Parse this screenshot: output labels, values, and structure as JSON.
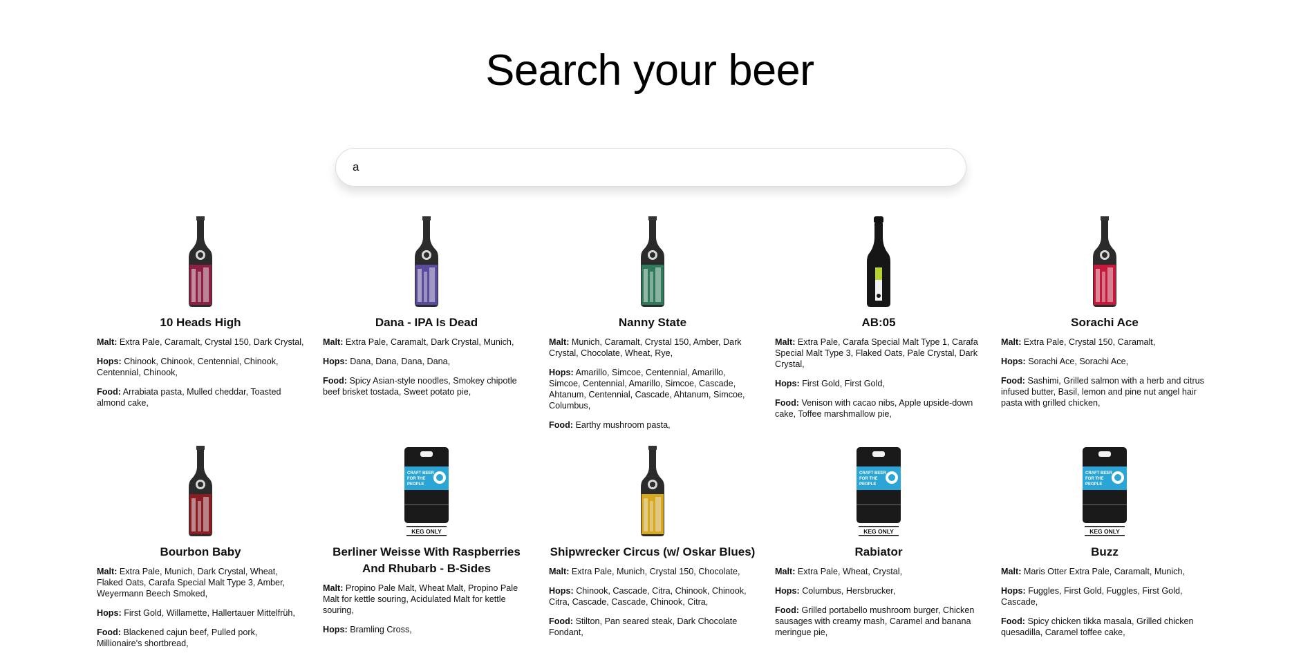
{
  "page": {
    "title": "Search your beer"
  },
  "search": {
    "value": "a",
    "placeholder": ""
  },
  "labels": {
    "malt": "Malt:",
    "hops": "Hops:",
    "food": "Food:"
  },
  "beers": [
    {
      "name": "10 Heads High",
      "malt": "Extra Pale, Caramalt, Crystal 150, Dark Crystal,",
      "hops": "Chinook, Chinook, Centennial, Chinook, Centennial, Chinook,",
      "food": "Arrabiata pasta, Mulled cheddar, Toasted almond cake,",
      "image": "bottle",
      "label_color": "#8e1f45"
    },
    {
      "name": "Dana - IPA Is Dead",
      "malt": "Extra Pale, Caramalt, Dark Crystal, Munich,",
      "hops": "Dana, Dana, Dana, Dana,",
      "food": "Spicy Asian-style noodles, Smokey chipotle beef brisket tostada, Sweet potato pie,",
      "image": "bottle",
      "label_color": "#5b4a9e"
    },
    {
      "name": "Nanny State",
      "malt": "Munich, Caramalt, Crystal 150, Amber, Dark Crystal, Chocolate, Wheat, Rye,",
      "hops": "Amarillo, Simcoe, Centennial, Amarillo, Simcoe, Centennial, Amarillo, Simcoe, Cascade, Ahtanum, Centennial, Cascade, Ahtanum, Simcoe, Columbus,",
      "food": "Earthy mushroom pasta,",
      "image": "bottle",
      "label_color": "#2f7a5a"
    },
    {
      "name": "AB:05",
      "malt": "Extra Pale, Carafa Special Malt Type 1, Carafa Special Malt Type 3, Flaked Oats, Pale Crystal, Dark Crystal,",
      "hops": "First Gold, First Gold,",
      "food": "Venison with cacao nibs, Apple upside-down cake, Toffee marshmallow pie,",
      "image": "champagne",
      "label_color": "#b5d334"
    },
    {
      "name": "Sorachi Ace",
      "malt": "Extra Pale, Crystal 150, Caramalt,",
      "hops": "Sorachi Ace, Sorachi Ace,",
      "food": "Sashimi, Grilled salmon with a herb and citrus infused butter, Basil, lemon and pine nut angel hair pasta with grilled chicken,",
      "image": "bottle",
      "label_color": "#c8193c"
    },
    {
      "name": "Bourbon Baby",
      "malt": "Extra Pale, Munich, Dark Crystal, Wheat, Flaked Oats, Carafa Special Malt Type 3, Amber, Weyermann Beech Smoked,",
      "hops": "First Gold, Willamette, Hallertauer Mittelfrüh,",
      "food": "Blackened cajun beef, Pulled pork, Millionaire's shortbread,",
      "image": "bottle",
      "label_color": "#8a1c24"
    },
    {
      "name": "Berliner Weisse With Raspberries And Rhubarb - B-Sides",
      "malt": "Propino Pale Malt, Wheat Malt, Propino Pale Malt for kettle souring, Acidulated Malt for kettle souring,",
      "hops": "Bramling Cross,",
      "food": "",
      "image": "keg",
      "label_color": "#2aa5d6",
      "keg_text": "KEG ONLY",
      "keg_label": "CRAFT BEER FOR THE PEOPLE"
    },
    {
      "name": "Shipwrecker Circus (w/ Oskar Blues)",
      "malt": "Extra Pale, Munich, Crystal 150, Chocolate,",
      "hops": "Chinook, Cascade, Citra, Chinook, Chinook, Citra, Cascade, Cascade, Chinook, Citra,",
      "food": "Stilton, Pan seared steak, Dark Chocolate Fondant,",
      "image": "bottle",
      "label_color": "#d9a91d"
    },
    {
      "name": "Rabiator",
      "malt": "Extra Pale, Wheat, Crystal,",
      "hops": "Columbus, Hersbrucker,",
      "food": "Grilled portabello mushroom burger, Chicken sausages with creamy mash, Caramel and banana meringue pie,",
      "image": "keg",
      "label_color": "#2aa5d6",
      "keg_text": "KEG ONLY",
      "keg_label": "CRAFT BEER FOR THE PEOPLE"
    },
    {
      "name": "Buzz",
      "malt": "Maris Otter Extra Pale, Caramalt, Munich,",
      "hops": "Fuggles, First Gold, Fuggles, First Gold, Cascade,",
      "food": "Spicy chicken tikka masala, Grilled chicken quesadilla, Caramel toffee cake,",
      "image": "keg",
      "label_color": "#2aa5d6",
      "keg_text": "KEG ONLY",
      "keg_label": "CRAFT BEER FOR THE PEOPLE"
    }
  ]
}
